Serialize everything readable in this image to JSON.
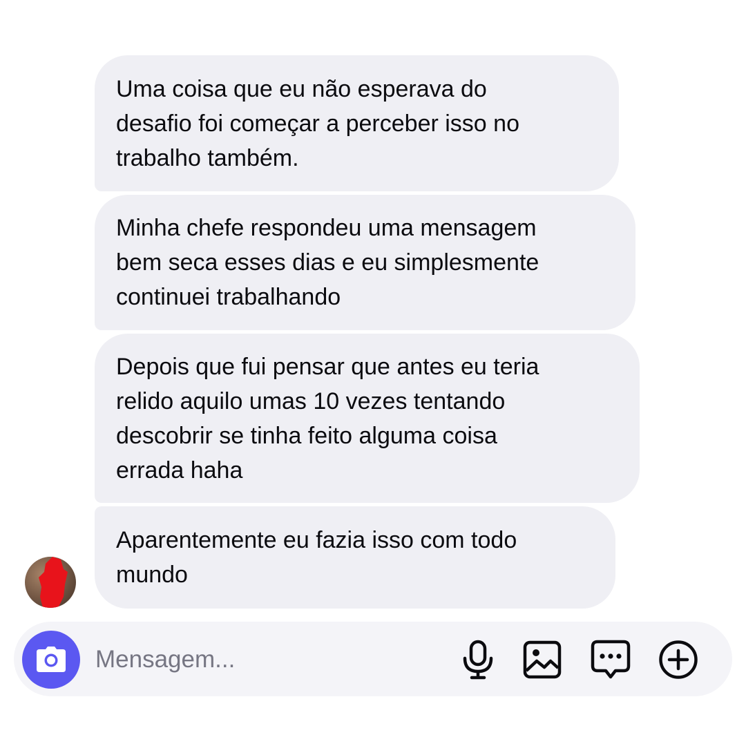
{
  "messages": [
    {
      "text": "Uma coisa que eu não esperava do\ndesafio foi começar a perceber isso no\ntrabalho também."
    },
    {
      "text": "Minha chefe respondeu uma mensagem\nbem seca esses dias e eu simplesmente\ncontinuei trabalhando"
    },
    {
      "text": "Depois que fui pensar que antes eu teria\nrelido aquilo umas 10 vezes tentando\ndescobrir se tinha feito alguma coisa\nerrada haha"
    },
    {
      "text": "Aparentemente eu fazia isso com todo\nmundo"
    }
  ],
  "composer": {
    "placeholder": "Mensagem...",
    "value": "",
    "icons": [
      "camera-icon",
      "microphone-icon",
      "gallery-icon",
      "sticker-icon",
      "plus-icon"
    ]
  },
  "colors": {
    "bubble": "#efeff4",
    "accent": "#5b58f1",
    "composer_bg": "#f4f4f8",
    "redaction": "#e8131b"
  }
}
